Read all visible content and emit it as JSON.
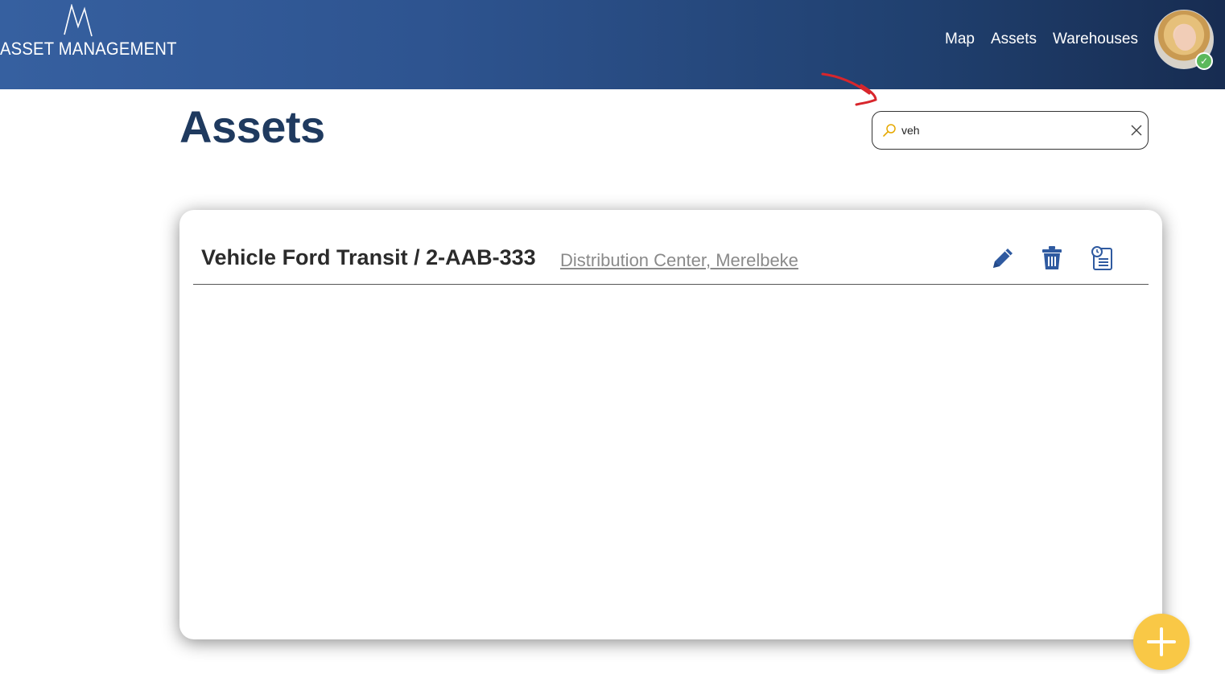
{
  "header": {
    "logo_text": "ASSET MANAGEMENT",
    "nav": {
      "map": "Map",
      "assets": "Assets",
      "warehouses": "Warehouses"
    },
    "user_status": "online"
  },
  "page": {
    "title": "Assets"
  },
  "search": {
    "value": "veh"
  },
  "assets": [
    {
      "name": "Vehicle Ford Transit / 2-AAB-333",
      "location": "Distribution Center, Merelbeke"
    }
  ],
  "icons": {
    "edit": "pencil-icon",
    "delete": "trash-icon",
    "details": "clipboard-list-icon",
    "search": "search-icon",
    "clear": "close-icon",
    "add": "plus-icon"
  },
  "colors": {
    "header_start": "#3660a0",
    "header_end": "#172c51",
    "title": "#1f3a5f",
    "action_icons": "#2f5aa0",
    "fab": "#f9c846",
    "annotation_arrow": "#d8262c"
  }
}
